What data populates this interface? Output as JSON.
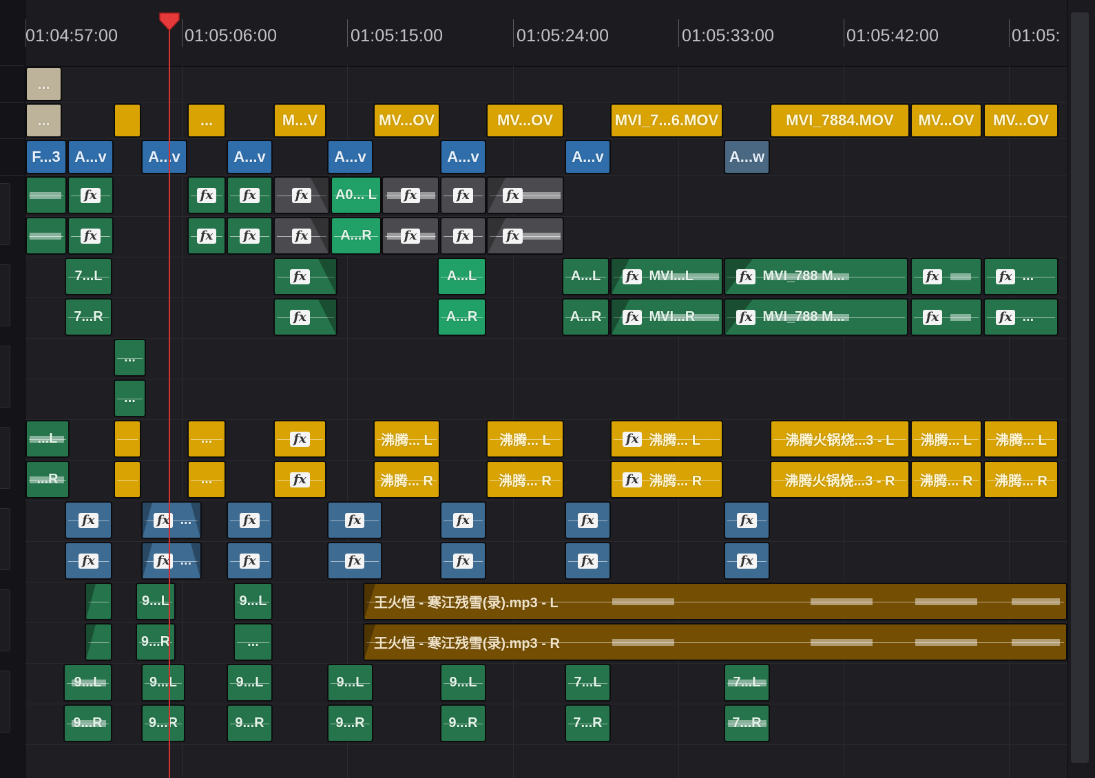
{
  "timecodes": [
    "01:04:57:00",
    "01:05:06:00",
    "01:05:15:00",
    "01:05:24:00",
    "01:05:33:00",
    "01:05:42:00",
    "01:05:"
  ],
  "colors": {
    "playhead": "#d63232",
    "video_tan": "#bdb39a",
    "video_gold": "#d9a403",
    "audio_green": "#25744b",
    "audio_blue": "#3d6b92",
    "music_brown": "#744e03"
  },
  "tracks": {
    "v3": [
      {
        "label": "..."
      }
    ],
    "v2": [
      {
        "label": "..."
      },
      {
        "label": ""
      },
      {
        "label": "..."
      },
      {
        "label": "M...V"
      },
      {
        "label": "MV...OV"
      },
      {
        "label": "MV...OV"
      },
      {
        "label": "MVI_7...6.MOV"
      },
      {
        "label": "MVI_7884.MOV"
      },
      {
        "label": "MV...OV"
      },
      {
        "label": "MV...OV"
      }
    ],
    "v1": [
      {
        "label": "F...3"
      },
      {
        "label": "A...v"
      },
      {
        "label": "A...v"
      },
      {
        "label": "A...v"
      },
      {
        "label": "A...v"
      },
      {
        "label": "A...v"
      },
      {
        "label": "A...v"
      },
      {
        "label": "A...w"
      }
    ],
    "a1": {
      "top": [
        {
          "label": ""
        },
        {
          "label": "fx"
        },
        {
          "label": "fx"
        },
        {
          "label": "fx"
        },
        {
          "label": "fx"
        },
        {
          "label": "A0... L"
        },
        {
          "label": "fx"
        },
        {
          "label": "fx"
        },
        {
          "label": "fx"
        }
      ],
      "bottom": [
        {
          "label": ""
        },
        {
          "label": "fx"
        },
        {
          "label": "fx"
        },
        {
          "label": "fx"
        },
        {
          "label": "fx"
        },
        {
          "label": "A...R"
        },
        {
          "label": "fx"
        },
        {
          "label": "fx"
        },
        {
          "label": "fx"
        }
      ]
    },
    "a2": {
      "top": [
        {
          "label": "7...L"
        },
        {
          "label": "fx"
        },
        {
          "label": "A...L"
        },
        {
          "label": "A...L"
        },
        {
          "label": "fx",
          "label2": "MVI...L"
        },
        {
          "label": "fx",
          "label2": "MVI_788 M..."
        },
        {
          "label": "fx"
        },
        {
          "label": "fx",
          "label2": "..."
        }
      ],
      "bottom": [
        {
          "label": "7...R"
        },
        {
          "label": "fx"
        },
        {
          "label": "A...R"
        },
        {
          "label": "A...R"
        },
        {
          "label": "fx",
          "label2": "MVI...R"
        },
        {
          "label": "fx",
          "label2": "MVI_788 M..."
        },
        {
          "label": "fx"
        },
        {
          "label": "fx",
          "label2": "..."
        }
      ]
    },
    "a3": {
      "top": [
        {
          "label": "..."
        }
      ],
      "bottom": [
        {
          "label": "..."
        }
      ]
    },
    "a4": {
      "top": [
        {
          "label": "...L"
        },
        {
          "label": ""
        },
        {
          "label": "..."
        },
        {
          "label": "fx"
        },
        {
          "label": "沸腾... L"
        },
        {
          "label": "沸腾... L"
        },
        {
          "label": "fx",
          "label2": "沸腾... L"
        },
        {
          "label": "沸腾火锅烧...3 - L"
        },
        {
          "label": "沸腾... L"
        },
        {
          "label": "沸腾... L"
        }
      ],
      "bottom": [
        {
          "label": "...R"
        },
        {
          "label": ""
        },
        {
          "label": "..."
        },
        {
          "label": "fx"
        },
        {
          "label": "沸腾... R"
        },
        {
          "label": "沸腾... R"
        },
        {
          "label": "fx",
          "label2": "沸腾... R"
        },
        {
          "label": "沸腾火锅烧...3 - R"
        },
        {
          "label": "沸腾... R"
        },
        {
          "label": "沸腾... R"
        }
      ]
    },
    "a5": {
      "top": [
        {
          "label": "fx"
        },
        {
          "label": "fx",
          "label2": "..."
        },
        {
          "label": "fx"
        },
        {
          "label": "fx"
        },
        {
          "label": "fx"
        },
        {
          "label": "fx"
        },
        {
          "label": "fx"
        }
      ],
      "bottom": [
        {
          "label": "fx"
        },
        {
          "label": "fx",
          "label2": "..."
        },
        {
          "label": "fx"
        },
        {
          "label": "fx"
        },
        {
          "label": "fx"
        },
        {
          "label": "fx"
        },
        {
          "label": "fx"
        }
      ]
    },
    "a6": {
      "top": [
        {
          "label": ""
        },
        {
          "label": "9...L"
        },
        {
          "label": "9...L"
        },
        {
          "label": "王火恒 - 寒江残雪(录).mp3 - L"
        }
      ],
      "bottom": [
        {
          "label": ""
        },
        {
          "label": "9...R"
        },
        {
          "label": "..."
        },
        {
          "label": "王火恒 - 寒江残雪(录).mp3 - R"
        }
      ]
    },
    "a7": {
      "top": [
        {
          "label": "9...L"
        },
        {
          "label": "9...L"
        },
        {
          "label": "9...L"
        },
        {
          "label": "9...L"
        },
        {
          "label": "9...L"
        },
        {
          "label": "7...L"
        },
        {
          "label": "7...L"
        }
      ],
      "bottom": [
        {
          "label": "9...R"
        },
        {
          "label": "9...R"
        },
        {
          "label": "9...R"
        },
        {
          "label": "9...R"
        },
        {
          "label": "9...R"
        },
        {
          "label": "7...R"
        },
        {
          "label": "7...R"
        }
      ]
    }
  }
}
